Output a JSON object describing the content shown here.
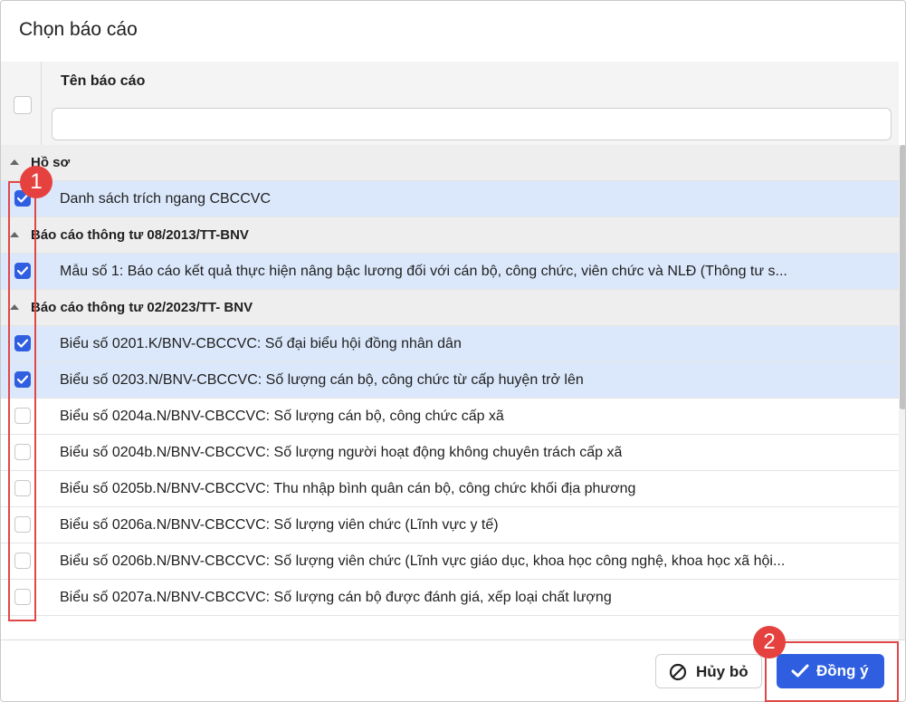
{
  "dialog": {
    "title": "Chọn báo cáo",
    "column_header": "Tên báo cáo",
    "filter_placeholder": ""
  },
  "groups": [
    {
      "label": "Hồ sơ",
      "items": [
        {
          "label": "Danh sách trích ngang CBCCVC",
          "checked": true
        }
      ]
    },
    {
      "label": "Báo cáo thông tư 08/2013/TT-BNV",
      "items": [
        {
          "label": "Mẫu số 1: Báo cáo kết quả thực hiện nâng bậc lương đối với cán bộ, công chức, viên chức và NLĐ (Thông tư s...",
          "checked": true
        }
      ]
    },
    {
      "label": "Báo cáo thông tư 02/2023/TT- BNV",
      "items": [
        {
          "label": "Biểu số 0201.K/BNV-CBCCVC: Số đại biểu hội đồng nhân dân",
          "checked": true
        },
        {
          "label": "Biểu số 0203.N/BNV-CBCCVC: Số lượng cán bộ, công chức từ cấp huyện trở lên",
          "checked": true
        },
        {
          "label": "Biểu số 0204a.N/BNV-CBCCVC: Số lượng cán bộ, công chức cấp xã",
          "checked": false
        },
        {
          "label": "Biểu số 0204b.N/BNV-CBCCVC: Số lượng người hoạt động không chuyên trách cấp xã",
          "checked": false
        },
        {
          "label": "Biểu số 0205b.N/BNV-CBCCVC: Thu nhập bình quân cán bộ, công chức khối địa phương",
          "checked": false
        },
        {
          "label": "Biểu số 0206a.N/BNV-CBCCVC: Số lượng viên chức (Lĩnh vực y tế)",
          "checked": false
        },
        {
          "label": "Biểu số 0206b.N/BNV-CBCCVC: Số lượng viên chức (Lĩnh vực giáo dục, khoa học công nghệ, khoa học xã hội...",
          "checked": false
        },
        {
          "label": "Biểu số 0207a.N/BNV-CBCCVC: Số lượng cán bộ được đánh giá, xếp loại chất lượng",
          "checked": false
        }
      ]
    }
  ],
  "footer": {
    "cancel_label": "Hủy bỏ",
    "ok_label": "Đồng ý"
  },
  "annotations": {
    "badge_1": "1",
    "badge_2": "2"
  },
  "colors": {
    "accent": "#2f5fe0",
    "selected_row": "#dbe8fb",
    "annotation": "#e04848"
  }
}
